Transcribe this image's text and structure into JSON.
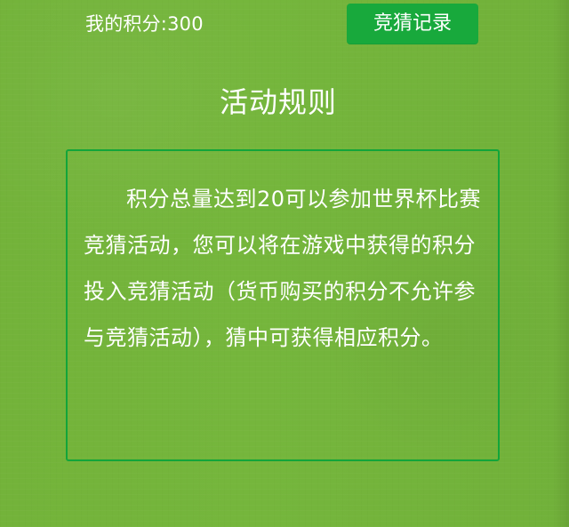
{
  "header": {
    "score_text": "我的积分:300",
    "record_button_label": "竞猜记录"
  },
  "rules": {
    "title": "活动规则",
    "body": "积分总量达到20可以参加世界杯比赛竞猜活动，您可以将在游戏中获得的积分投入竞猜活动（货币购买的积分不允许参与竞猜活动），猜中可获得相应积分。"
  },
  "colors": {
    "background": "#74b43b",
    "button": "#18a93c",
    "border": "#12a53a",
    "text": "#ffffff"
  }
}
